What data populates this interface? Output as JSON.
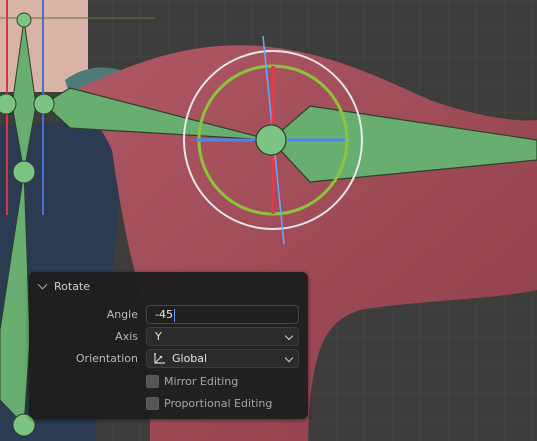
{
  "panel": {
    "title": "Rotate",
    "angle_label": "Angle",
    "angle_value": "-45",
    "axis_label": "Axis",
    "axis_value": "Y",
    "orientation_label": "Orientation",
    "orientation_value": "Global",
    "mirror_label": "Mirror Editing",
    "proportional_label": "Proportional Editing"
  },
  "colors": {
    "skin": "#a24e59",
    "bone": "#66ad6e",
    "gizmo_green": "#8bc43b",
    "gizmo_red": "#e13a4a",
    "gizmo_blue": "#4f86ee",
    "accent_caret": "#5f9bff"
  },
  "icons": {
    "collapse": "chevron-down-icon",
    "orientation": "global-orientation-icon",
    "dropdown": "chevron-down-icon"
  }
}
